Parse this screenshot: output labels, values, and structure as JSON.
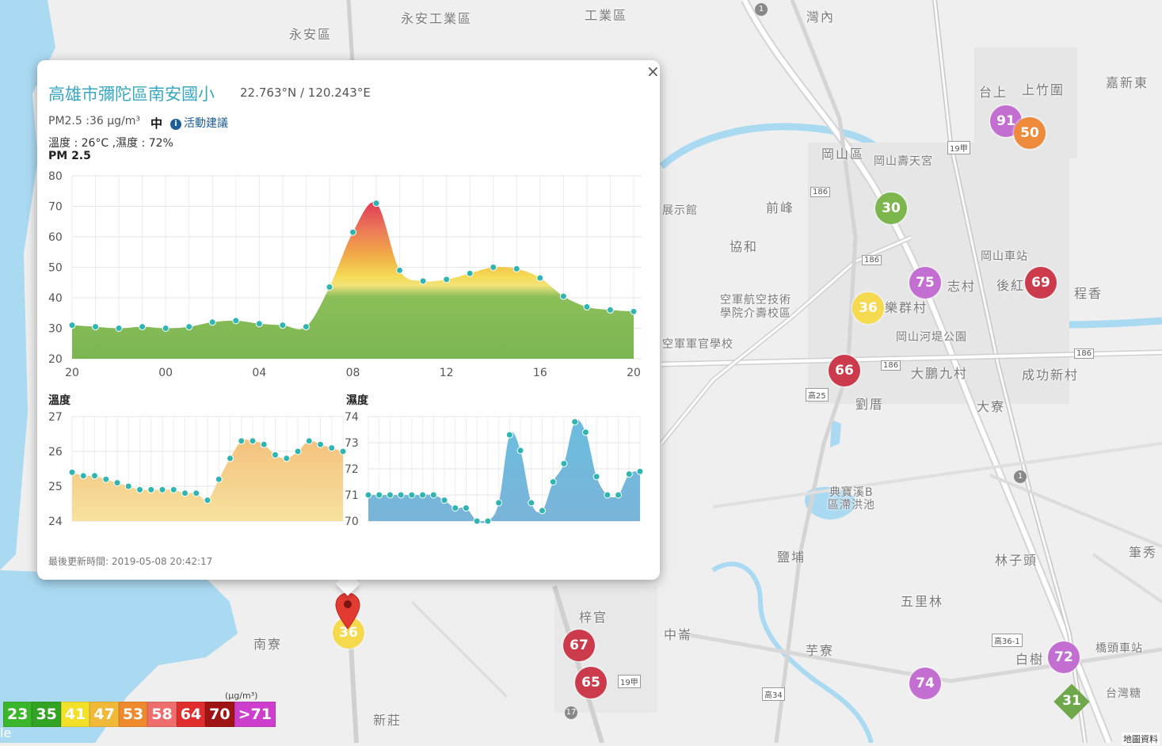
{
  "map": {
    "places": [
      {
        "label": "永安工業區",
        "small": false
      },
      {
        "label": "永安區",
        "small": false
      },
      {
        "label": "工業區",
        "small": false
      },
      {
        "label": "灣內",
        "small": false
      },
      {
        "label": "台上",
        "small": false
      },
      {
        "label": "上竹圍",
        "small": false
      },
      {
        "label": "嘉新東",
        "small": false
      },
      {
        "label": "岡山區",
        "small": false
      },
      {
        "label": "岡山壽天宮",
        "small": true
      },
      {
        "label": "前峰",
        "small": false
      },
      {
        "label": "協和",
        "small": false
      },
      {
        "label": "展示館",
        "small": true
      },
      {
        "label": "空軍航空技術",
        "small": true
      },
      {
        "label": "學院介壽校區",
        "small": true
      },
      {
        "label": "空軍軍官學校",
        "small": true
      },
      {
        "label": "樂群村",
        "small": false
      },
      {
        "label": "志村",
        "small": false
      },
      {
        "label": "後紅",
        "small": false
      },
      {
        "label": "程香",
        "small": false
      },
      {
        "label": "岡山車站",
        "small": true
      },
      {
        "label": "岡山河堤公園",
        "small": true
      },
      {
        "label": "大鵬九村",
        "small": false
      },
      {
        "label": "成功新村",
        "small": false
      },
      {
        "label": "劉厝",
        "small": false
      },
      {
        "label": "大寮",
        "small": false
      },
      {
        "label": "典寶溪B",
        "small": true
      },
      {
        "label": "區滯洪池",
        "small": true
      },
      {
        "label": "鹽埔",
        "small": false
      },
      {
        "label": "林子頭",
        "small": false
      },
      {
        "label": "筆秀",
        "small": false
      },
      {
        "label": "五里林",
        "small": false
      },
      {
        "label": "梓官",
        "small": false
      },
      {
        "label": "中崙",
        "small": false
      },
      {
        "label": "芋寮",
        "small": false
      },
      {
        "label": "白樹",
        "small": false
      },
      {
        "label": "橋頭車站",
        "small": true
      },
      {
        "label": "台灣糖",
        "small": true
      },
      {
        "label": "南寮",
        "small": false
      },
      {
        "label": "新莊",
        "small": false
      }
    ],
    "road_labels": [
      "186",
      "186",
      "186",
      "186",
      "19甲",
      "19甲",
      "高25",
      "高34",
      "高36-1",
      "1",
      "1",
      "17"
    ],
    "clusters": [
      {
        "value": "91",
        "color": "#c36fd1"
      },
      {
        "value": "50",
        "color": "#ee8a3c"
      },
      {
        "value": "30",
        "color": "#7cb64d"
      },
      {
        "value": "75",
        "color": "#c36fd1"
      },
      {
        "value": "36",
        "color": "#f5d94f"
      },
      {
        "value": "69",
        "color": "#cc3b4b"
      },
      {
        "value": "66",
        "color": "#cc3b4b"
      },
      {
        "value": "67",
        "color": "#cc3b4b"
      },
      {
        "value": "65",
        "color": "#cc3b4b"
      },
      {
        "value": "74",
        "color": "#c36fd1"
      },
      {
        "value": "72",
        "color": "#c36fd1"
      },
      {
        "value": "36",
        "color": "#f5d94f"
      }
    ],
    "diamond": {
      "value": "31",
      "color": "#6ea84a"
    },
    "attribution": "地圖資料",
    "left_edge_text": "le"
  },
  "popup": {
    "close_label": "×",
    "title": "高雄市彌陀區南安國小",
    "coords": "22.763°N / 120.243°E",
    "pm_text": "PM2.5 :36 μg/m³",
    "level": "中",
    "advice": "活動建議",
    "advice_icon": "i",
    "weather": "溫度 : 26°C ,濕度 : 72%",
    "pm_chart_title": "PM 2.5",
    "temp_chart_title": "溫度",
    "hum_chart_title": "濕度",
    "updated": "最後更新時間: 2019-05-08 20:42:17"
  },
  "chart_data": [
    {
      "type": "area",
      "title": "PM 2.5",
      "x_tick_labels": [
        "20",
        "00",
        "04",
        "08",
        "12",
        "16",
        "20"
      ],
      "y_tick_labels": [
        "20",
        "30",
        "40",
        "50",
        "60",
        "70",
        "80"
      ],
      "ylim": [
        20,
        80
      ],
      "x_hours": [
        20,
        21,
        22,
        23,
        24,
        25,
        26,
        27,
        28,
        29,
        30,
        31,
        32,
        33,
        34,
        35,
        36,
        37,
        38,
        39,
        40,
        41,
        42,
        43,
        44
      ],
      "values": [
        31,
        30.5,
        30,
        30.5,
        30,
        30.5,
        32,
        32.5,
        31.5,
        31,
        30.5,
        43.5,
        61.5,
        71,
        49,
        45.5,
        46,
        48,
        50,
        49.5,
        46.5,
        40.5,
        37,
        36,
        35.5
      ],
      "grid": true
    },
    {
      "type": "area",
      "title": "溫度",
      "y_tick_labels": [
        "24",
        "25",
        "26",
        "27"
      ],
      "ylim": [
        24,
        27
      ],
      "values": [
        25.4,
        25.3,
        25.3,
        25.2,
        25.1,
        25.0,
        24.9,
        24.9,
        24.9,
        24.9,
        24.8,
        24.8,
        24.6,
        25.2,
        25.8,
        26.3,
        26.3,
        26.2,
        25.9,
        25.8,
        26.0,
        26.3,
        26.2,
        26.1,
        26.0
      ],
      "color": "#f3c27e",
      "grid": true
    },
    {
      "type": "area",
      "title": "濕度",
      "y_tick_labels": [
        "70",
        "71",
        "72",
        "73",
        "74"
      ],
      "ylim": [
        70,
        74
      ],
      "values": [
        71,
        71,
        71,
        71,
        71,
        71,
        71,
        70.8,
        70.5,
        70.5,
        70,
        70,
        70.7,
        73.3,
        72.7,
        70.7,
        70.4,
        71.5,
        72.2,
        73.8,
        73.4,
        71.7,
        71,
        71,
        71.8,
        71.9
      ],
      "color": "#6bbde0",
      "grid": true
    }
  ],
  "legend": {
    "unit": "(μg/m³)",
    "cells": [
      {
        "label": "23",
        "color": "#3bb52b"
      },
      {
        "label": "35",
        "color": "#33a324"
      },
      {
        "label": "41",
        "color": "#f2e02b"
      },
      {
        "label": "47",
        "color": "#f0b93a"
      },
      {
        "label": "53",
        "color": "#ee8a2d"
      },
      {
        "label": "58",
        "color": "#ee6d6d"
      },
      {
        "label": "64",
        "color": "#e02d2d"
      },
      {
        "label": "70",
        "color": "#9f1414"
      },
      {
        "label": ">71",
        "color": "#cc3ecc"
      }
    ]
  }
}
